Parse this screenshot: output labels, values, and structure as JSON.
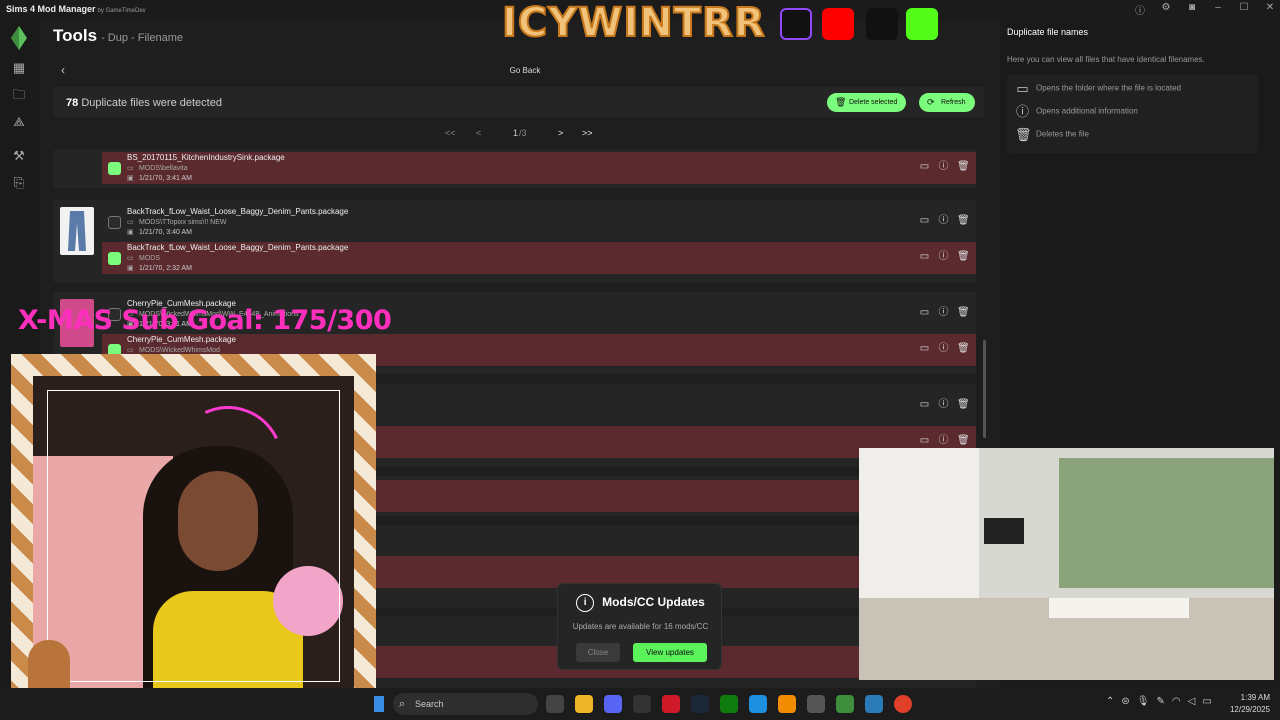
{
  "app": {
    "title": "Sims 4 Mod Manager",
    "by": "by GameTimeDev"
  },
  "header": {
    "title": "Tools",
    "subtitle": "- Dup - Filename"
  },
  "nav": {
    "go_back": "Go Back"
  },
  "summary": {
    "count": "78",
    "label": "Duplicate files were detected",
    "delete_label": "Delete selected",
    "refresh_label": "Refresh"
  },
  "pager": {
    "first": "<<",
    "prev": "<",
    "current": "1",
    "total": "/3",
    "next": ">",
    "last": ">>"
  },
  "groups": [
    {
      "rows": [
        {
          "name": "BS_20170115_KitchenIndustrySink.package",
          "path": "MODS\\bellavita",
          "date": "1/21/70, 3:41 AM"
        }
      ]
    },
    {
      "rows": [
        {
          "name": "BackTrack_fLow_Waist_Loose_Baggy_Denim_Pants.package",
          "path": "MODS\\TTopixx sims\\!! NEW",
          "date": "1/21/70, 3:40 AM"
        },
        {
          "name": "BackTrack_fLow_Waist_Loose_Baggy_Denim_Pants.package",
          "path": "MODS",
          "date": "1/21/70, 2:32 AM"
        }
      ]
    },
    {
      "rows": [
        {
          "name": "CherryPie_CumMesh.package",
          "path": "MODS\\WickedWhimsMod\\WW_E404B_Animations",
          "date": "1/21/70, 3:41 AM"
        },
        {
          "name": "CherryPie_CumMesh.package",
          "path": "MODS\\WickedWhimsMod",
          "date": ""
        }
      ]
    }
  ],
  "right_panel": {
    "title": "Duplicate file names",
    "description": "Here you can view all files that have identical filenames.",
    "legend": [
      {
        "icon": "folder-icon",
        "label": "Opens the folder where the file is located"
      },
      {
        "icon": "info-icon",
        "label": "Opens additional information"
      },
      {
        "icon": "trash-icon",
        "label": "Deletes the file"
      }
    ]
  },
  "toast": {
    "title": "Mods/CC Updates",
    "message": "Updates are available for 16 mods/CC",
    "close": "Close",
    "view": "View updates"
  },
  "overlay": {
    "banner": "ICYWINTRR",
    "goal": "X-MAS Sub Goal: 175/300"
  },
  "taskbar": {
    "search": "Search",
    "time": "1:39 AM",
    "date": "12/29/2025"
  },
  "colors": {
    "accent": "#7cfc7c",
    "row_red": "#5a2a2e",
    "goal_pink": "#ff2fbe"
  }
}
